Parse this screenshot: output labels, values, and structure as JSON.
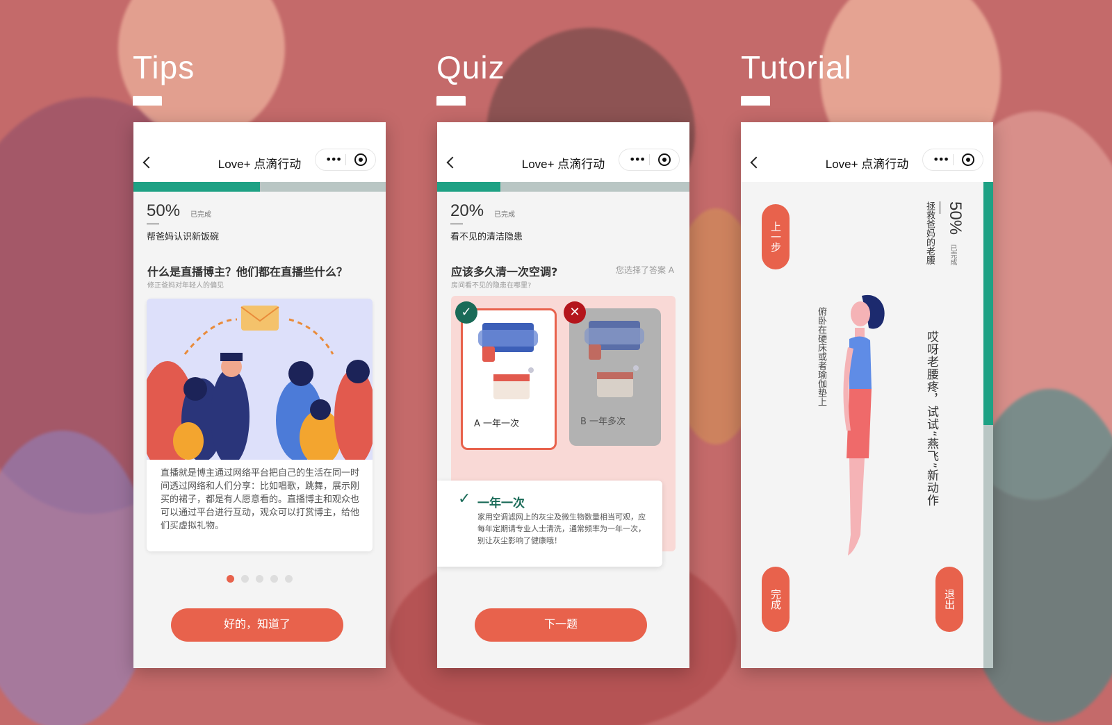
{
  "sections": [
    {
      "title": "Tips"
    },
    {
      "title": "Quiz"
    },
    {
      "title": "Tutorial"
    }
  ],
  "app": {
    "title": "Love+ 点滴行动",
    "menu_icon": "more-dots-icon",
    "close_icon": "target-icon"
  },
  "tips": {
    "progress_pct": "50%",
    "progress_value": 0.5,
    "done_label": "已完成",
    "level_name": "帮爸妈认识新饭碗",
    "question": "什么是直播博主？他们都在直播些什么？",
    "subtitle": "修正爸妈对年轻人的偏见",
    "body": "直播就是博主通过网络平台把自己的生活在同一时间透过网络和人们分享：比如唱歌，跳舞，展示刚买的裙子，都是有人愿意看的。直播博主和观众也可以通过平台进行互动，观众可以打赏博主，给他们买虚拟礼物。",
    "pager_total": 5,
    "pager_active": 1,
    "button": "好的，知道了"
  },
  "quiz": {
    "progress_pct": "20%",
    "progress_value": 0.2,
    "done_label": "已完成",
    "level_name": "看不见的清洁隐患",
    "question": "应该多久清一次空调?",
    "subtitle": "房间看不见的隐患在哪里?",
    "chosen": "您选择了答案 A",
    "options": [
      {
        "label": "A 一年一次",
        "state": "correct"
      },
      {
        "label": "B 一年多次",
        "state": "wrong"
      }
    ],
    "answer_title": "一年一次",
    "answer_text": "家用空调滤网上的灰尘及微生物数量相当可观，应每年定期请专业人士清洗，通常频率为一年一次，别让灰尘影响了健康哦！",
    "button": "下一题"
  },
  "tutorial": {
    "progress_pct": "50%",
    "progress_value": 0.5,
    "done_label": "已完成",
    "level_name": "拯救爸妈的老腰",
    "prev_button": "上一步",
    "instruction_main": "哎呀老腰疼，试试“燕飞”新动作",
    "instruction_sub": "俯卧在硬床或者瑜伽垫上",
    "done_button": "完成",
    "exit_button": "退出"
  },
  "colors": {
    "accent": "#e8624c",
    "progress": "#1ea184",
    "track": "#b9c6c4",
    "correct": "#1a6b58",
    "wrong": "#b4151c"
  }
}
